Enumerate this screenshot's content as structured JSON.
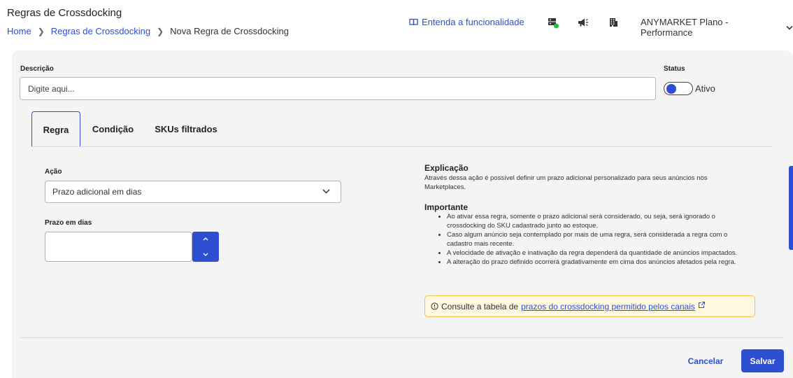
{
  "header": {
    "title": "Regras de Crossdocking",
    "breadcrumb": {
      "home": "Home",
      "parent": "Regras de Crossdocking",
      "current": "Nova Regra de Crossdocking"
    },
    "help_link": "Entenda a funcionalidade",
    "account": "ANYMARKET Plano - Performance",
    "icons": [
      "server-status-icon",
      "megaphone-icon",
      "building-icon"
    ]
  },
  "form": {
    "description_label": "Descrição",
    "description_placeholder": "Digite aqui...",
    "status_label": "Status",
    "status_value": "Ativo"
  },
  "tabs": [
    {
      "label": "Regra",
      "active": true
    },
    {
      "label": "Condição",
      "active": false
    },
    {
      "label": "SKUs filtrados",
      "active": false
    }
  ],
  "rule": {
    "action_label": "Ação",
    "action_value": "Prazo adicional em dias",
    "days_label": "Prazo em dias",
    "days_value": ""
  },
  "explanation": {
    "title": "Explicação",
    "text": "Através dessa ação é possível definir um prazo adicional personalizado para seus anúncios nos Marketplaces.",
    "important_title": "Importante",
    "items": [
      "Ao ativar essa regra, somente o prazo adicional será considerado, ou seja, será ignorado o crossdocking do SKU cadastrado junto ao estoque.",
      "Caso algum anúncio seja contemplado por mais de uma regra, será considerada a regra com o cadastro mais recente.",
      "A velocidade de ativação e inativação da regra dependerá da quantidade de anúncios impactados.",
      "A alteração do prazo definido ocorrerá gradativamente em cima dos anúncios afetados pela regra."
    ],
    "notice_text": "Consulte a tabela de",
    "notice_link": "prazos do crossdocking permitido pelos canais"
  },
  "footer": {
    "cancel": "Cancelar",
    "save": "Salvar"
  },
  "colors": {
    "accent": "#2e4fd1",
    "status_online": "#1fbf4a",
    "notice_bg": "#fff8e1",
    "notice_border": "#f0c24c"
  }
}
